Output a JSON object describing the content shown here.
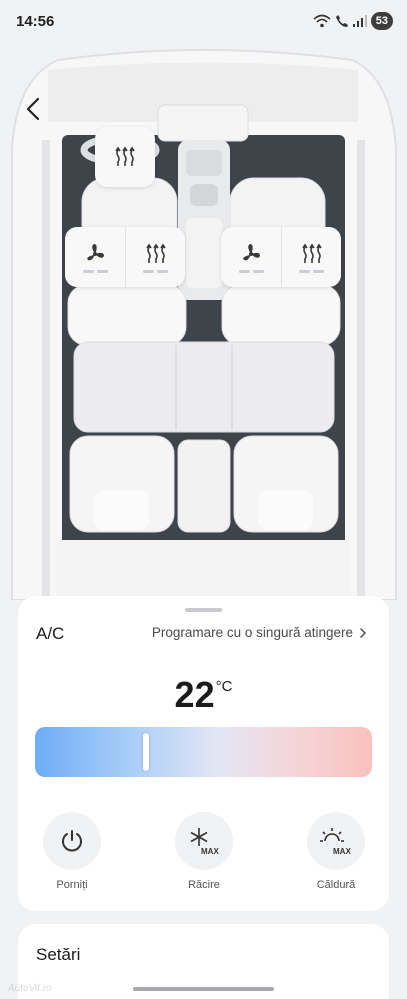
{
  "status_bar": {
    "time": "14:56",
    "battery": "53",
    "icons": [
      "wifi-icon",
      "call-icon",
      "signal-icon"
    ]
  },
  "car": {
    "icons": [
      "back-icon",
      "seat-heat-icon",
      "fan-icon"
    ],
    "driver_fan_level": 2,
    "driver_heat_level": 2,
    "passenger_fan_level": 2,
    "passenger_heat_level": 2
  },
  "ac": {
    "title": "A/C",
    "schedule_link": "Programare cu o singură atingere",
    "temperature": "22",
    "unit": "°C",
    "slider_fraction": 0.33,
    "slider_colors": [
      "#6eadf7",
      "#e4e6f3",
      "#f9c1bd"
    ],
    "modes": [
      {
        "icon": "power-icon",
        "label": "Porniți",
        "badge": ""
      },
      {
        "icon": "snowflake-max-icon",
        "label": "Răcire",
        "badge": "MAX"
      },
      {
        "icon": "sun-max-icon",
        "label": "Căldură",
        "badge": "MAX"
      }
    ]
  },
  "settings": {
    "title": "Setări"
  },
  "watermark": "AutoVit.ro"
}
